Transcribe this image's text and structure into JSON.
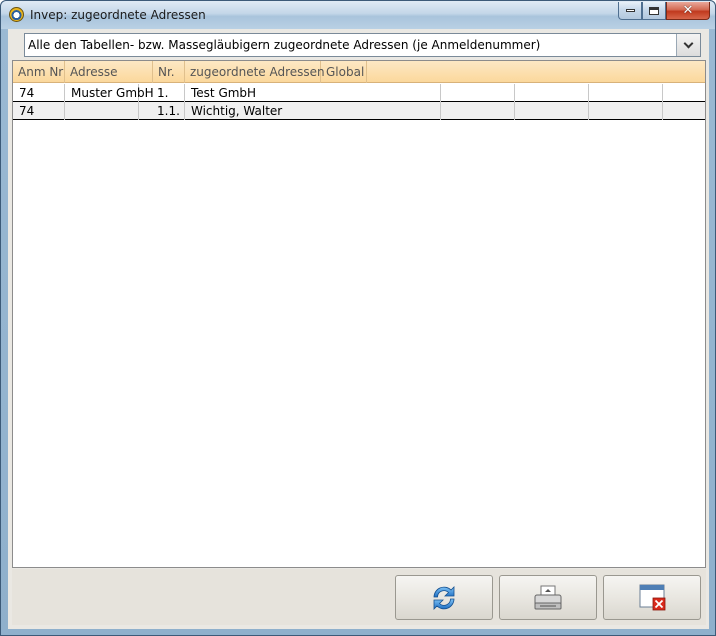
{
  "window": {
    "title": "Invep: zugeordnete Adressen"
  },
  "filter": {
    "selected": "Alle den Tabellen- bzw. Massegläubigern zugeordnete Adressen (je Anmeldenummer)"
  },
  "table": {
    "columns": [
      "Anm Nr",
      "Adresse",
      "Nr.",
      "zugeordnete Adressen",
      "Global"
    ],
    "rows": [
      {
        "anm_nr": "74",
        "adresse": "Muster GmbH",
        "nr": "1.",
        "zugeordnete": "Test GmbH",
        "global": ""
      },
      {
        "anm_nr": "74",
        "adresse": "",
        "nr": "1.1.",
        "zugeordnete": "Wichtig, Walter",
        "global": ""
      }
    ]
  },
  "icons": {
    "refresh": "refresh-icon",
    "print": "print-icon",
    "close": "close-window-icon"
  },
  "colors": {
    "header_bg": "#fbd89c",
    "selected_row": "#f0f0f0"
  }
}
